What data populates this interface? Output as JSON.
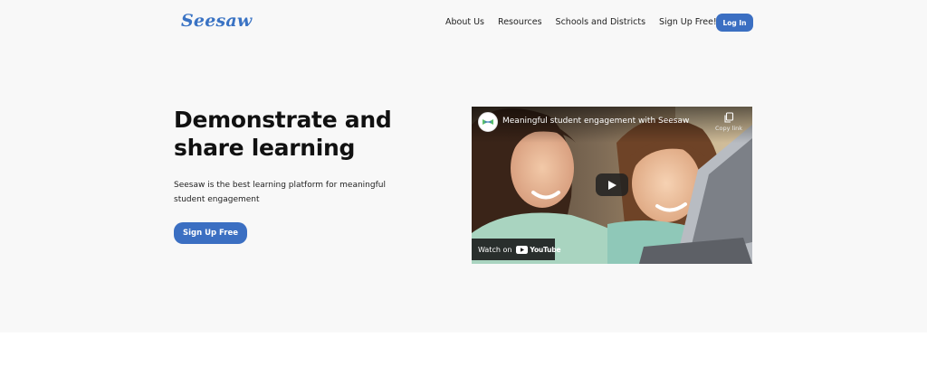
{
  "header": {
    "logo_text": "Seesaw",
    "nav_items": [
      {
        "label": "About Us"
      },
      {
        "label": "Resources"
      },
      {
        "label": "Schools and Districts"
      },
      {
        "label": "Sign Up Free!"
      }
    ],
    "login_label": "Log In"
  },
  "hero": {
    "title_line1": "Demonstrate and",
    "title_line2": "share learning",
    "desc_line1": "Seesaw is the best learning platform for meaningful",
    "desc_line2": "student engagement",
    "cta_label": "Sign Up Free"
  },
  "video": {
    "title": "Meaningful student engagement with Seesaw",
    "copy_link_label": "Copy link",
    "watch_on_label": "Watch on",
    "youtube_label": "YouTube",
    "icons": {
      "channel": "seesaw-channel-icon",
      "copy": "copy-icon",
      "play": "play-icon",
      "youtube": "youtube-logo-icon"
    }
  },
  "colors": {
    "brand_blue": "#3b6fc2",
    "logo_blue": "#3a73c4",
    "hero_bg": "#f8f8f8",
    "page_bg": "#ffffff"
  }
}
